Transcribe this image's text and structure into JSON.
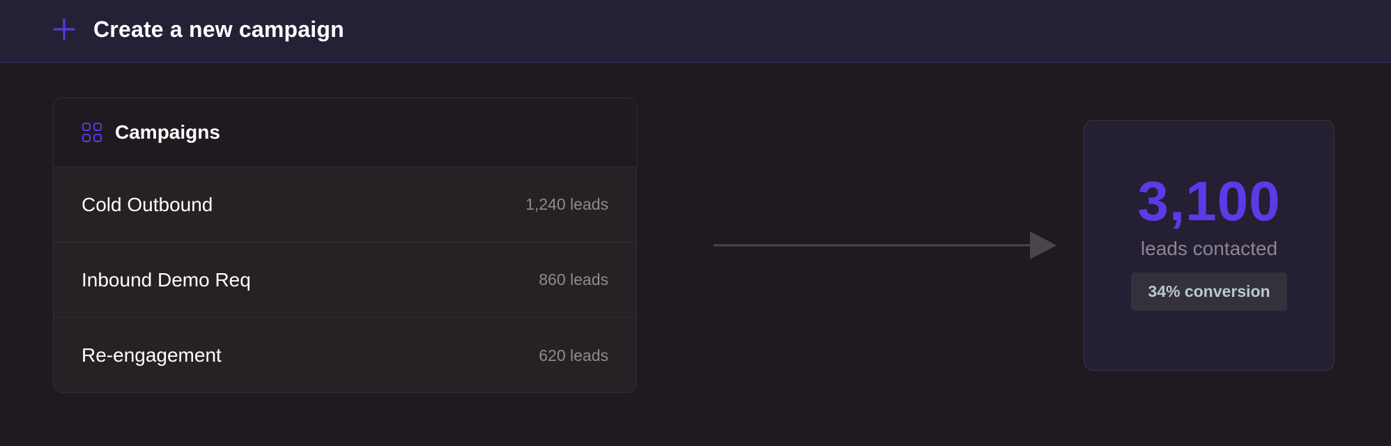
{
  "topbar": {
    "create_label": "Create a new campaign",
    "icon": "plus-icon"
  },
  "campaigns": {
    "title": "Campaigns",
    "icon": "grid-icon",
    "items": [
      {
        "name": "Cold Outbound",
        "count": "1,240 leads"
      },
      {
        "name": "Inbound Demo Req",
        "count": "860 leads"
      },
      {
        "name": "Re-engagement",
        "count": "620 leads"
      }
    ]
  },
  "summary": {
    "value": "3,100",
    "label": "leads contacted",
    "badge": "34% conversion"
  },
  "colors": {
    "accent": "#5b3be6",
    "background": "#1f1a1f",
    "topbar": "#252036"
  }
}
